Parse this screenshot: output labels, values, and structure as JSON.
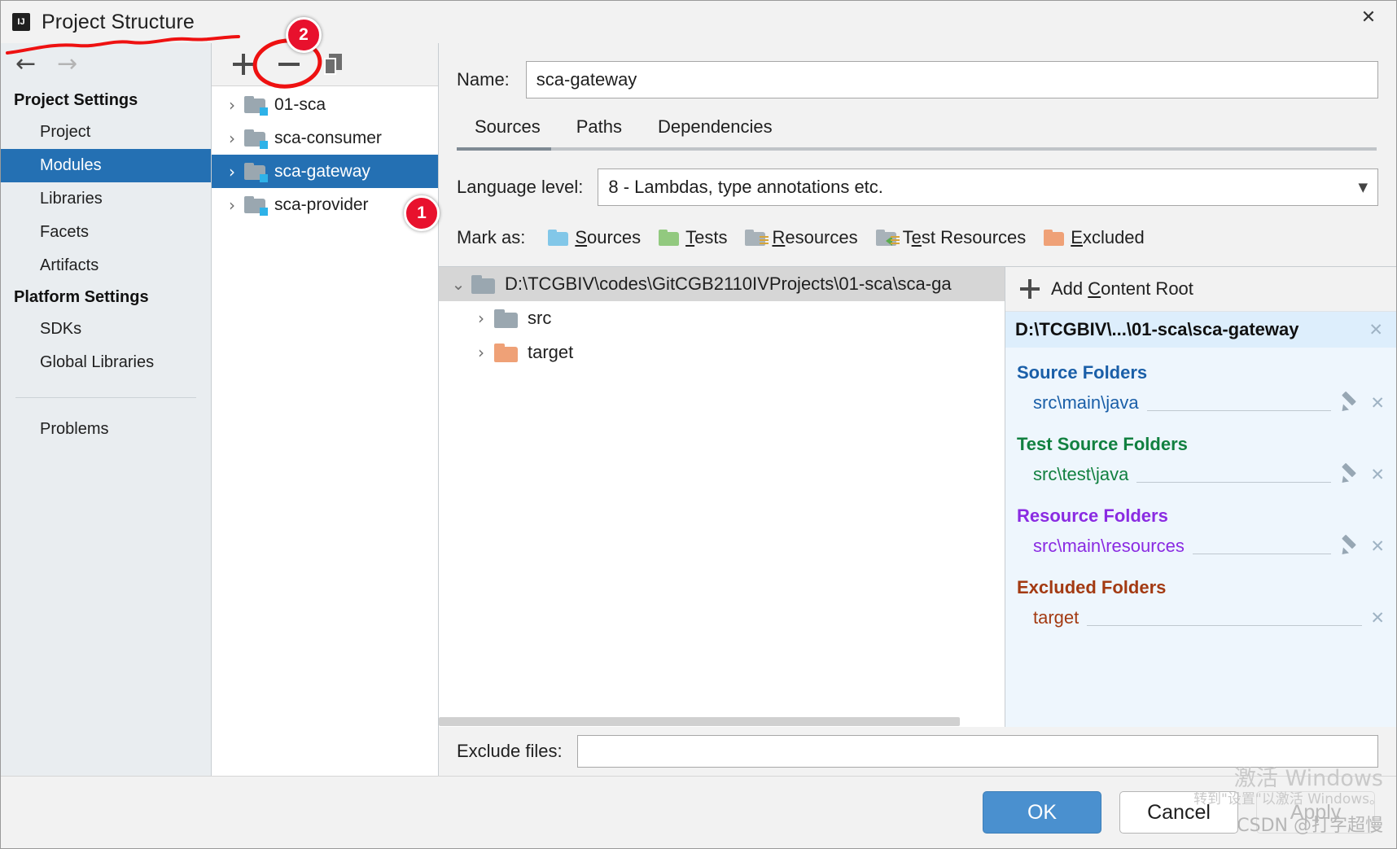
{
  "window": {
    "title": "Project Structure",
    "logo_icon": "intellij-idea-logo",
    "close_icon": "close-icon"
  },
  "nav_toolbar": {
    "back_icon": "arrow-left-icon",
    "forward_icon": "arrow-right-icon"
  },
  "sidebar": {
    "groups": [
      {
        "title": "Project Settings",
        "items": [
          {
            "label": "Project",
            "selected": false
          },
          {
            "label": "Modules",
            "selected": true
          },
          {
            "label": "Libraries",
            "selected": false
          },
          {
            "label": "Facets",
            "selected": false
          },
          {
            "label": "Artifacts",
            "selected": false
          }
        ]
      },
      {
        "title": "Platform Settings",
        "items": [
          {
            "label": "SDKs",
            "selected": false
          },
          {
            "label": "Global Libraries",
            "selected": false
          }
        ]
      }
    ],
    "footer_item": {
      "label": "Problems"
    }
  },
  "modules_panel": {
    "toolbar": {
      "add_icon": "plus-icon",
      "remove_icon": "minus-icon",
      "copy_icon": "copy-icon"
    },
    "items": [
      {
        "label": "01-sca",
        "selected": false,
        "expand_icon": "chevron-right-icon"
      },
      {
        "label": "sca-consumer",
        "selected": false,
        "expand_icon": "chevron-right-icon"
      },
      {
        "label": "sca-gateway",
        "selected": true,
        "expand_icon": "chevron-right-icon"
      },
      {
        "label": "sca-provider",
        "selected": false,
        "expand_icon": "chevron-right-icon"
      }
    ]
  },
  "detail": {
    "name_label": "Name:",
    "name_value": "sca-gateway",
    "tabs": [
      {
        "label": "Sources",
        "active": true
      },
      {
        "label": "Paths",
        "active": false
      },
      {
        "label": "Dependencies",
        "active": false
      }
    ],
    "language_level_label": "Language level:",
    "language_level_value": "8 - Lambdas, type annotations etc.",
    "language_level_caret_icon": "chevron-down-icon",
    "mark_as_label": "Mark as:",
    "mark_as_options": [
      {
        "label": "Sources",
        "mnemonic": "S",
        "color": "#82c7e8",
        "icon": "folder-sources-icon"
      },
      {
        "label": "Tests",
        "mnemonic": "T",
        "color": "#92c97f",
        "icon": "folder-tests-icon"
      },
      {
        "label": "Resources",
        "mnemonic": "R",
        "color": "#a8b2b9",
        "icon": "folder-resources-icon"
      },
      {
        "label": "Test Resources",
        "mnemonic": "e",
        "color": "#a8b2b9",
        "icon": "folder-test-resources-icon"
      },
      {
        "label": "Excluded",
        "mnemonic": "E",
        "color": "#efa177",
        "icon": "folder-excluded-icon"
      }
    ],
    "content_tree": {
      "root": {
        "label": "D:\\TCGBIV\\codes\\GitCGB2110IVProjects\\01-sca\\sca-ga",
        "collapse_icon": "chevron-down-icon",
        "icon": "folder-icon"
      },
      "children": [
        {
          "label": "src",
          "color": "#9aa7b0",
          "expand_icon": "chevron-right-icon",
          "icon": "folder-icon"
        },
        {
          "label": "target",
          "color": "#efa177",
          "expand_icon": "chevron-right-icon",
          "icon": "folder-excluded-icon"
        }
      ]
    },
    "exclude_files_label": "Exclude files:",
    "exclude_files_value": "",
    "exclude_files_placeholder": ""
  },
  "content_root_panel": {
    "add_content_root_label": "Add Content Root",
    "add_icon": "plus-icon",
    "root_path": "D:\\TCGBIV\\...\\01-sca\\sca-gateway",
    "root_remove_icon": "close-icon",
    "groups": [
      {
        "title": "Source Folders",
        "color": "#1a5fa8",
        "entries": [
          {
            "path": "src\\main\\java",
            "edit_icon": "pencil-icon",
            "remove_icon": "close-icon",
            "has_edit": true
          }
        ]
      },
      {
        "title": "Test Source Folders",
        "color": "#118040",
        "entries": [
          {
            "path": "src\\test\\java",
            "edit_icon": "pencil-icon",
            "remove_icon": "close-icon",
            "has_edit": true
          }
        ]
      },
      {
        "title": "Resource Folders",
        "color": "#8a2be2",
        "entries": [
          {
            "path": "src\\main\\resources",
            "edit_icon": "pencil-icon",
            "remove_icon": "close-icon",
            "has_edit": true
          }
        ]
      },
      {
        "title": "Excluded Folders",
        "color": "#a33a12",
        "entries": [
          {
            "path": "target",
            "remove_icon": "close-icon",
            "has_edit": false
          }
        ]
      }
    ]
  },
  "footer": {
    "ok_label": "OK",
    "cancel_label": "Cancel",
    "apply_label": "Apply"
  },
  "annotations": {
    "badge_1": "1",
    "badge_2": "2"
  },
  "watermark": {
    "line1": "激活 Windows",
    "line2": "转到\"设置\"以激活 Windows。",
    "line3": "CSDN @打字超慢"
  },
  "colors": {
    "accent": "#2470b3",
    "primary_button": "#4a90cf",
    "annotation_red": "#e8112d",
    "panel_blue": "#eef6fd"
  }
}
